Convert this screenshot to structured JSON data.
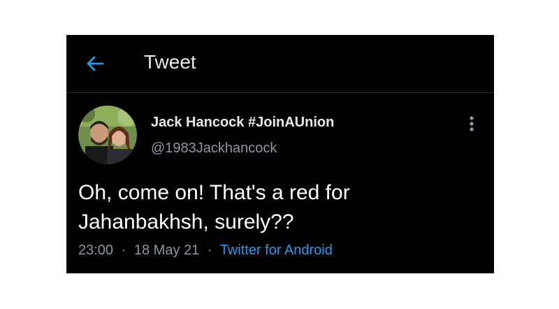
{
  "header": {
    "title": "Tweet",
    "back_icon": "arrow-left-icon",
    "accent_color": "#1d9bf0"
  },
  "tweet": {
    "author": {
      "display_name": "Jack Hancock #JoinAUnion",
      "handle": "@1983Jackhancock",
      "avatar_icon": "avatar"
    },
    "text": "Oh, come on!  That's a red for Jahanbakhsh, surely??",
    "meta": {
      "time": "23:00",
      "separator": "·",
      "date": "18 May 21",
      "source": "Twitter for Android"
    },
    "more_icon": "more-vertical-icon"
  },
  "colors": {
    "background": "#000000",
    "text_primary": "#e7e9ea",
    "text_secondary": "#8b98a5",
    "link": "#1d9bf0",
    "divider": "#2f3336"
  }
}
